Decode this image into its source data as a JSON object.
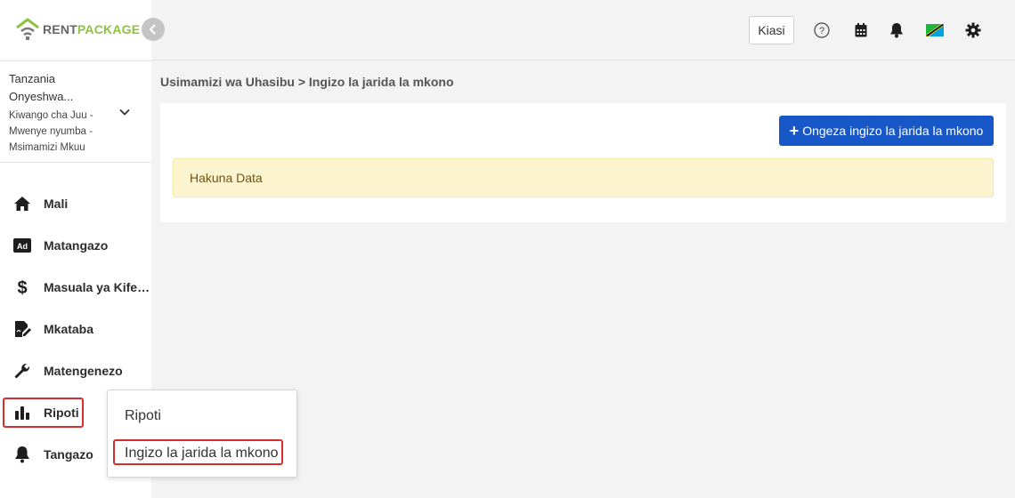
{
  "brand": {
    "name_part1": "RENT",
    "name_part2": "PACKAGE"
  },
  "account": {
    "line1": "Tanzania",
    "line2": "Onyeshwa...",
    "sub": "Kiwango cha Juu - Mwenye nyumba - Msimamizi Mkuu"
  },
  "sidebar": {
    "items": [
      {
        "label": "Mali",
        "icon": "home-icon"
      },
      {
        "label": "Matangazo",
        "icon": "ad-icon"
      },
      {
        "label": "Masuala ya Kifed...",
        "icon": "dollar-icon"
      },
      {
        "label": "Mkataba",
        "icon": "contract-icon"
      },
      {
        "label": "Matengenezo",
        "icon": "wrench-icon"
      },
      {
        "label": "Ripoti",
        "icon": "bar-chart-icon"
      },
      {
        "label": "Tangazo",
        "icon": "bell-icon"
      }
    ]
  },
  "header": {
    "kiasi_label": "Kiasi",
    "icons": [
      "help-icon",
      "calendar-icon",
      "notification-bell-icon",
      "tanzania-flag-icon",
      "settings-gear-icon"
    ]
  },
  "breadcrumb": {
    "root": "Usimamizi wa Uhasibu",
    "separator": ">",
    "current": "Ingizo la jarida la mkono"
  },
  "main": {
    "add_button_label": "Ongeza ingizo la jarida la mkono",
    "empty_message": "Hakuna Data"
  },
  "popup": {
    "items": [
      {
        "label": "Ripoti"
      },
      {
        "label": "Ingizo la jarida la mkono"
      }
    ]
  },
  "colors": {
    "primary": "#1857c8",
    "brand_green": "#8cc43f",
    "highlight_red": "#d32f2f",
    "empty_bg": "#fcf3cf"
  }
}
